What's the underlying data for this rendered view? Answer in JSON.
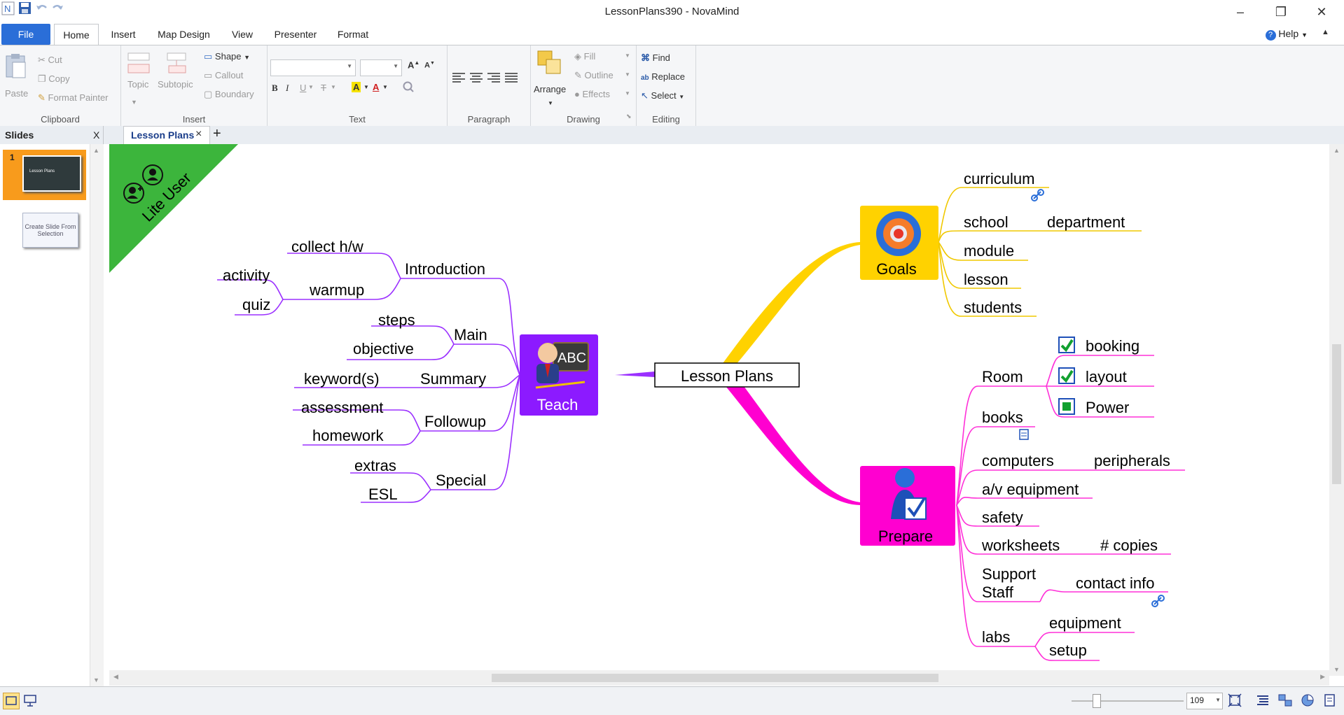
{
  "window": {
    "title": "LessonPlans390 - NovaMind"
  },
  "quick_access": {
    "app_icon": "novamind-logo-icon",
    "save": "save-icon",
    "undo": "undo-icon",
    "redo": "redo-icon"
  },
  "menu_tabs": [
    "File",
    "Home",
    "Insert",
    "Map Design",
    "View",
    "Presenter",
    "Format"
  ],
  "help_label": "Help",
  "ribbon": {
    "clipboard": {
      "paste": "Paste",
      "cut": "Cut",
      "copy": "Copy",
      "format_painter": "Format Painter",
      "label": "Clipboard"
    },
    "insert": {
      "topic": "Topic",
      "subtopic": "Subtopic",
      "shape": "Shape",
      "callout": "Callout",
      "boundary": "Boundary",
      "label": "Insert"
    },
    "text": {
      "bold": "B",
      "italic": "I",
      "underline": "U",
      "label": "Text"
    },
    "paragraph": {
      "label": "Paragraph"
    },
    "drawing": {
      "arrange": "Arrange",
      "fill": "Fill",
      "outline": "Outline",
      "effects": "Effects",
      "label": "Drawing"
    },
    "editing": {
      "find": "Find",
      "replace": "Replace",
      "select": "Select",
      "label": "Editing"
    }
  },
  "slides_panel": {
    "title": "Slides",
    "close": "X",
    "slide_number": "1",
    "slide_thumb_text": "Lesson Plans",
    "create_slide": "Create Slide From Selection"
  },
  "doc_tab": {
    "title": "Lesson Plans",
    "close": "×",
    "add": "+"
  },
  "banner": {
    "text": "Lite User"
  },
  "map": {
    "center": "Lesson Plans",
    "goals": {
      "label": "Goals",
      "children": [
        "curriculum",
        "school",
        "department",
        "module",
        "lesson",
        "students"
      ]
    },
    "teach": {
      "label": "Teach",
      "children": [
        "Introduction",
        "collect h/w",
        "warmup",
        "activity",
        "quiz",
        "Main",
        "steps",
        "objective",
        "Summary",
        "keyword(s)",
        "Followup",
        "assessment",
        "homework",
        "Special",
        "extras",
        "ESL"
      ]
    },
    "prepare": {
      "label": "Prepare",
      "children": [
        "Room",
        "booking",
        "layout",
        "Power",
        "books",
        "computers",
        "peripherals",
        "a/v equipment",
        "safety",
        "worksheets",
        "# copies",
        "Support",
        "Staff",
        "contact info",
        "labs",
        "equipment",
        "setup"
      ]
    },
    "colors": {
      "goals": "#ffd200",
      "teach": "#8c1aff",
      "prepare": "#ff00d0",
      "teach_line": "#9b30ff",
      "prepare_line": "#ff30d8",
      "goals_line": "#f0c800"
    }
  },
  "status": {
    "zoom": "109"
  }
}
